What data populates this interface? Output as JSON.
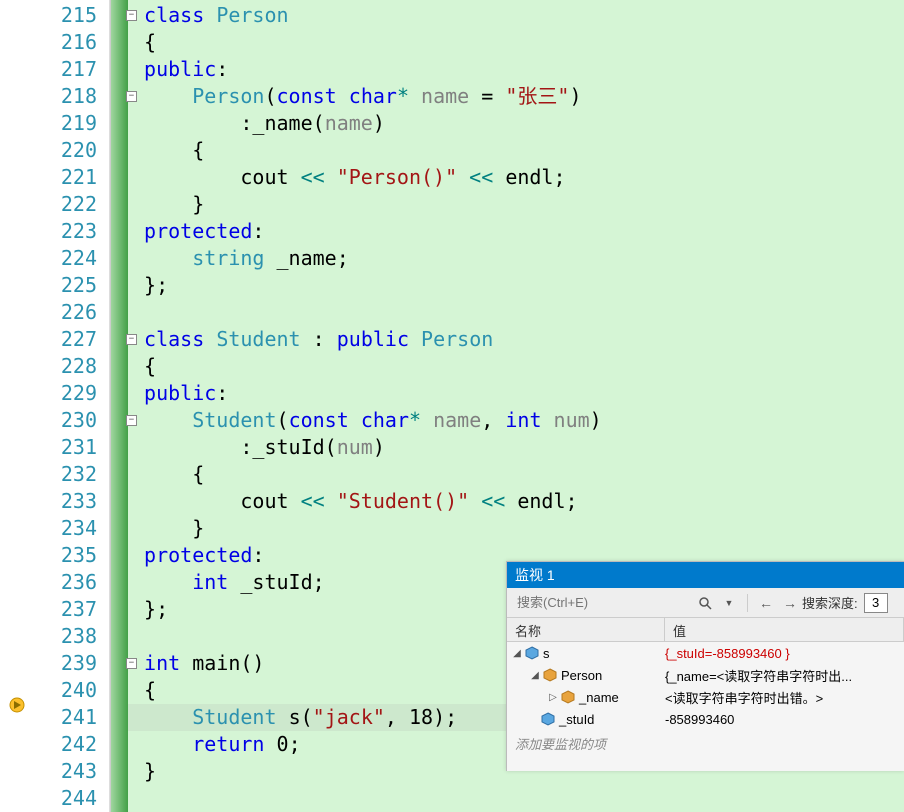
{
  "line_numbers": [
    "215",
    "216",
    "217",
    "218",
    "219",
    "220",
    "221",
    "222",
    "223",
    "224",
    "225",
    "226",
    "227",
    "228",
    "229",
    "230",
    "231",
    "232",
    "233",
    "234",
    "235",
    "236",
    "237",
    "238",
    "239",
    "240",
    "241",
    "242",
    "243",
    "244"
  ],
  "code": {
    "l215": {
      "kw": "class",
      "cls": "Person"
    },
    "l216": {
      "txt": "{"
    },
    "l217": {
      "kw": "public",
      "colon": ":"
    },
    "l218": {
      "cls": "Person",
      "op1": "(",
      "kw1": "const",
      "kw2": "char",
      "op2": "*",
      "param": "name",
      "op3": " = ",
      "str": "\"张三\"",
      "op4": ")"
    },
    "l219": {
      "op1": ":",
      "name": "_name",
      "op2": "(",
      "param": "name",
      "op3": ")"
    },
    "l220": {
      "txt": "{"
    },
    "l221": {
      "name": "cout",
      "op1": " << ",
      "str": "\"Person()\"",
      "op2": " << ",
      "name2": "endl",
      "semi": ";"
    },
    "l222": {
      "txt": "}"
    },
    "l223": {
      "kw": "protected",
      "colon": ":"
    },
    "l224": {
      "type": "string",
      "name": "_name",
      "semi": ";"
    },
    "l225": {
      "txt": "};"
    },
    "l227": {
      "kw": "class",
      "cls": "Student",
      "colon": " : ",
      "kw2": "public",
      "cls2": "Person"
    },
    "l228": {
      "txt": "{"
    },
    "l229": {
      "kw": "public",
      "colon": ":"
    },
    "l230": {
      "cls": "Student",
      "op1": "(",
      "kw1": "const",
      "kw2": "char",
      "op2": "*",
      "param": "name",
      "comma": ", ",
      "kw3": "int",
      "param2": "num",
      "op3": ")"
    },
    "l231": {
      "op1": ":",
      "name": "_stuId",
      "op2": "(",
      "param": "num",
      "op3": ")"
    },
    "l232": {
      "txt": "{"
    },
    "l233": {
      "name": "cout",
      "op1": " << ",
      "str": "\"Student()\"",
      "op2": " << ",
      "name2": "endl",
      "semi": ";"
    },
    "l234": {
      "txt": "}"
    },
    "l235": {
      "kw": "protected",
      "colon": ":"
    },
    "l236": {
      "kw": "int",
      "name": "_stuId",
      "semi": ";"
    },
    "l237": {
      "txt": "};"
    },
    "l239": {
      "kw": "int",
      "name": "main",
      "op1": "()"
    },
    "l240": {
      "txt": "{"
    },
    "l241": {
      "cls": "Student",
      "name": "s",
      "op1": "(",
      "str": "\"jack\"",
      "comma": ", ",
      "num": "18",
      "op2": ");"
    },
    "l242": {
      "kw": "return",
      "num": "0",
      "semi": ";"
    },
    "l243": {
      "txt": "}"
    }
  },
  "watch": {
    "title": "监视 1",
    "search_placeholder": "搜索(Ctrl+E)",
    "depth_label": "搜索深度:",
    "depth_value": "3",
    "header_name": "名称",
    "header_value": "值",
    "rows": [
      {
        "indent": 0,
        "expander": "▢",
        "icon": "blue",
        "name": "s",
        "value": "{_stuId=-858993460 }",
        "red": true
      },
      {
        "indent": 1,
        "expander": "▢",
        "icon": "orange",
        "name": "Person",
        "value": "{_name=<读取字符串字符时出..."
      },
      {
        "indent": 2,
        "expander": "▷",
        "icon": "orange",
        "name": "_name",
        "value": "<读取字符串字符时出错。>"
      },
      {
        "indent": 1,
        "expander": "",
        "icon": "blue",
        "name": "_stuId",
        "value": "-858993460"
      }
    ],
    "add_item": "添加要监视的项"
  }
}
